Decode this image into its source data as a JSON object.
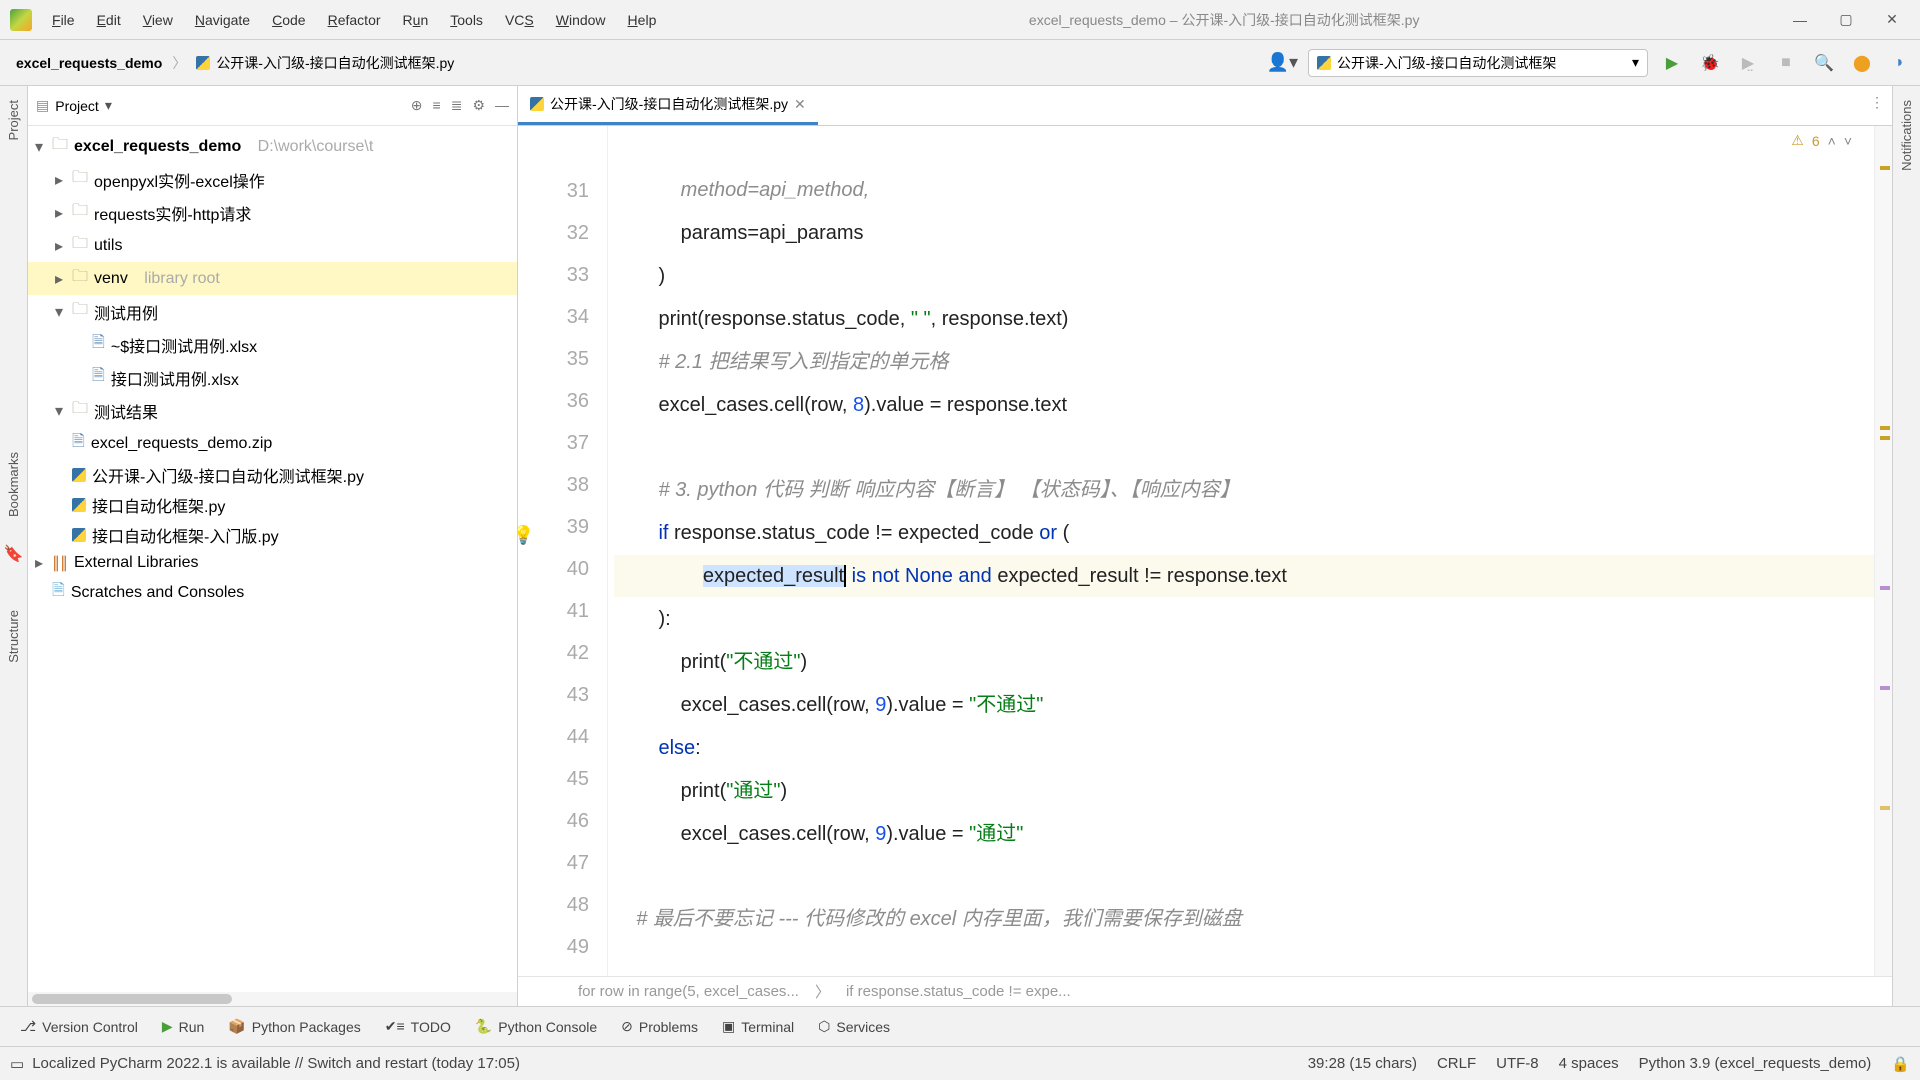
{
  "title": "excel_requests_demo – 公开课-入门级-接口自动化测试框架.py",
  "menu": [
    "File",
    "Edit",
    "View",
    "Navigate",
    "Code",
    "Refactor",
    "Run",
    "Tools",
    "VCS",
    "Window",
    "Help"
  ],
  "breadcrumb": {
    "root": "excel_requests_demo",
    "file": "公开课-入门级-接口自动化测试框架.py"
  },
  "run_config": "公开课-入门级-接口自动化测试框架",
  "project": {
    "label": "Project",
    "root": "excel_requests_demo",
    "root_path": "D:\\work\\course\\t",
    "items": [
      "openpyxl实例-excel操作",
      "requests实例-http请求",
      "utils",
      "venv",
      "测试用例",
      "~$接口测试用例.xlsx",
      "接口测试用例.xlsx",
      "测试结果",
      "excel_requests_demo.zip",
      "公开课-入门级-接口自动化测试框架.py",
      "接口自动化框架.py",
      "接口自动化框架-入门版.py"
    ],
    "venv_note": "library root",
    "ext_libs": "External Libraries",
    "scratches": "Scratches and Consoles"
  },
  "tab": "公开课-入门级-接口自动化测试框架.py",
  "warnings": "6",
  "gutter_lines": [
    "",
    "31",
    "32",
    "33",
    "34",
    "35",
    "36",
    "37",
    "38",
    "39",
    "40",
    "41",
    "42",
    "43",
    "44",
    "45",
    "46",
    "47",
    "48",
    "49"
  ],
  "code": {
    "l0a": "            method=api_method,",
    "l31a": "            params=api_params",
    "l32a": "        )",
    "l33a": "        print(response.status_code, ",
    "l33b": "\" \"",
    "l33c": ", response.text)",
    "l34a": "        ",
    "l34b": "# 2.1 把结果写入到指定的单元格",
    "l35a": "        excel_cases.cell(row, ",
    "l35b": "8",
    "l35c": ").value = response.text",
    "l37a": "        ",
    "l37b": "# 3. python 代码 判断 响应内容【断言】 【状态码】、【响应内容】",
    "l38a": "        ",
    "l38b": "if",
    "l38c": " response.status_code != expected_code ",
    "l38d": "or",
    "l38e": " (",
    "l39a": "                ",
    "l39b": "expected_result",
    "l39c": " ",
    "l39d": "is not",
    "l39e": " ",
    "l39f": "None",
    "l39g": " ",
    "l39h": "and",
    "l39i": " expected_result != response.text",
    "l40a": "        ):",
    "l41a": "            print(",
    "l41b": "\"不通过\"",
    "l41c": ")",
    "l42a": "            excel_cases.cell(row, ",
    "l42b": "9",
    "l42c": ").value = ",
    "l42d": "\"不通过\"",
    "l43a": "        ",
    "l43b": "else",
    "l43c": ":",
    "l44a": "            print(",
    "l44b": "\"通过\"",
    "l44c": ")",
    "l45a": "            excel_cases.cell(row, ",
    "l45b": "9",
    "l45c": ").value = ",
    "l45d": "\"通过\"",
    "l47a": "    ",
    "l47b": "# 最后不要忘记 --- 代码修改的 excel 内存里面，我们需要保存到磁盘"
  },
  "editor_breadcrumb": {
    "a": "for row in range(5, excel_cases...",
    "b": "if response.status_code != expe..."
  },
  "bottom_tabs": [
    "Version Control",
    "Run",
    "Python Packages",
    "TODO",
    "Python Console",
    "Problems",
    "Terminal",
    "Services"
  ],
  "status": {
    "msg": "Localized PyCharm 2022.1 is available // Switch and restart (today 17:05)",
    "pos": "39:28 (15 chars)",
    "eol": "CRLF",
    "enc": "UTF-8",
    "indent": "4 spaces",
    "sdk": "Python 3.9 (excel_requests_demo)"
  },
  "side_tabs": {
    "project": "Project",
    "bookmarks": "Bookmarks",
    "structure": "Structure",
    "notifications": "Notifications"
  }
}
